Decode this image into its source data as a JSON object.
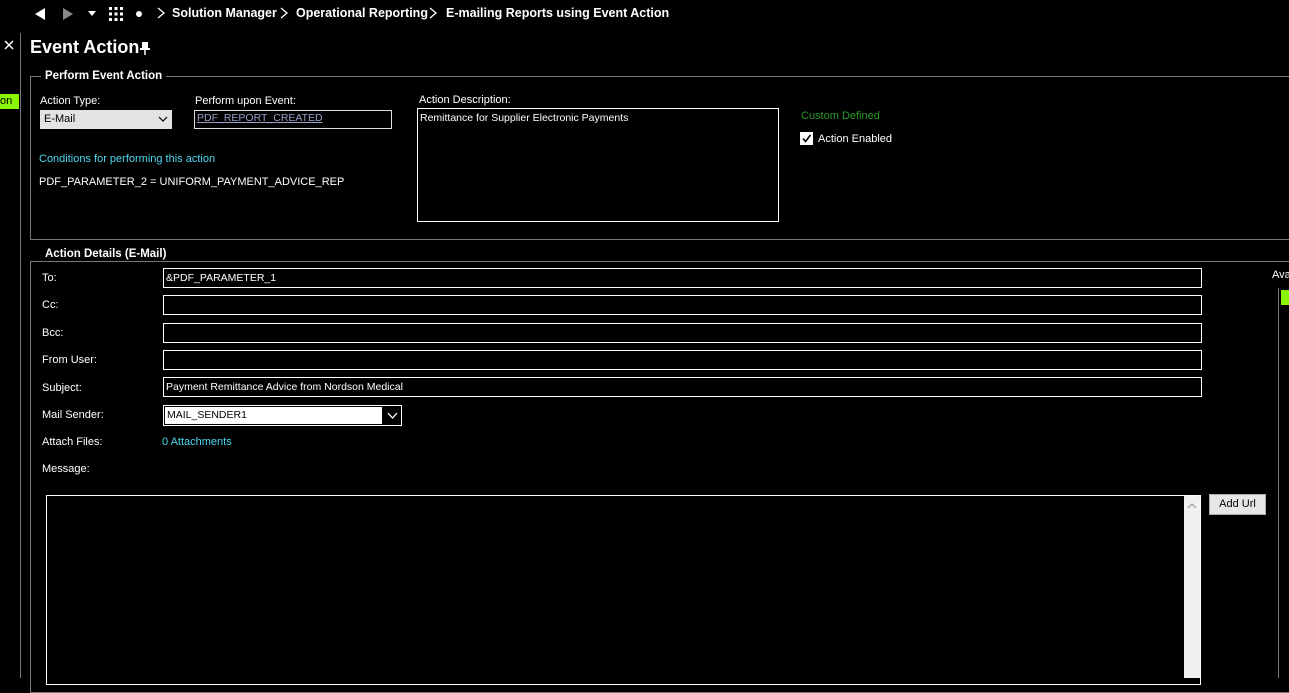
{
  "nav": {
    "breadcrumb": [
      "Solution Manager",
      "Operational Reporting",
      "E-mailing Reports using Event Action"
    ]
  },
  "page": {
    "title": "Event Action",
    "left_tab_label": "on"
  },
  "perform_event_action": {
    "legend": "Perform Event Action",
    "action_type_label": "Action Type:",
    "action_type_value": "E-Mail",
    "perform_upon_event_label": "Perform upon Event:",
    "perform_upon_event_value": "PDF_REPORT_CREATED",
    "action_description_label": "Action Description:",
    "action_description_value": "Remittance for Supplier Electronic Payments",
    "custom_defined_label": "Custom Defined",
    "action_enabled_label": "Action Enabled",
    "action_enabled_checked": true,
    "conditions_label": "Conditions for performing this action",
    "conditions_value": "PDF_PARAMETER_2 = UNIFORM_PAYMENT_ADVICE_REP"
  },
  "action_details": {
    "legend": "Action Details (E-Mail)",
    "to_label": "To:",
    "to_value": "&PDF_PARAMETER_1",
    "cc_label": "Cc:",
    "cc_value": "",
    "bcc_label": "Bcc:",
    "bcc_value": "",
    "from_user_label": "From User:",
    "from_user_value": "",
    "subject_label": "Subject:",
    "subject_value": "Payment Remittance Advice from Nordson Medical",
    "mail_sender_label": "Mail Sender:",
    "mail_sender_value": "MAIL_SENDER1",
    "attach_files_label": "Attach Files:",
    "attachments_link": "0 Attachments",
    "message_label": "Message:",
    "message_value": "",
    "add_url_label": "Add Url",
    "right_panel_label": "Ava"
  },
  "colors": {
    "background": "#000000",
    "accent_green": "#8af500",
    "link_cyan": "#4fd8f0",
    "custom_defined_green": "#2a9a2a"
  }
}
